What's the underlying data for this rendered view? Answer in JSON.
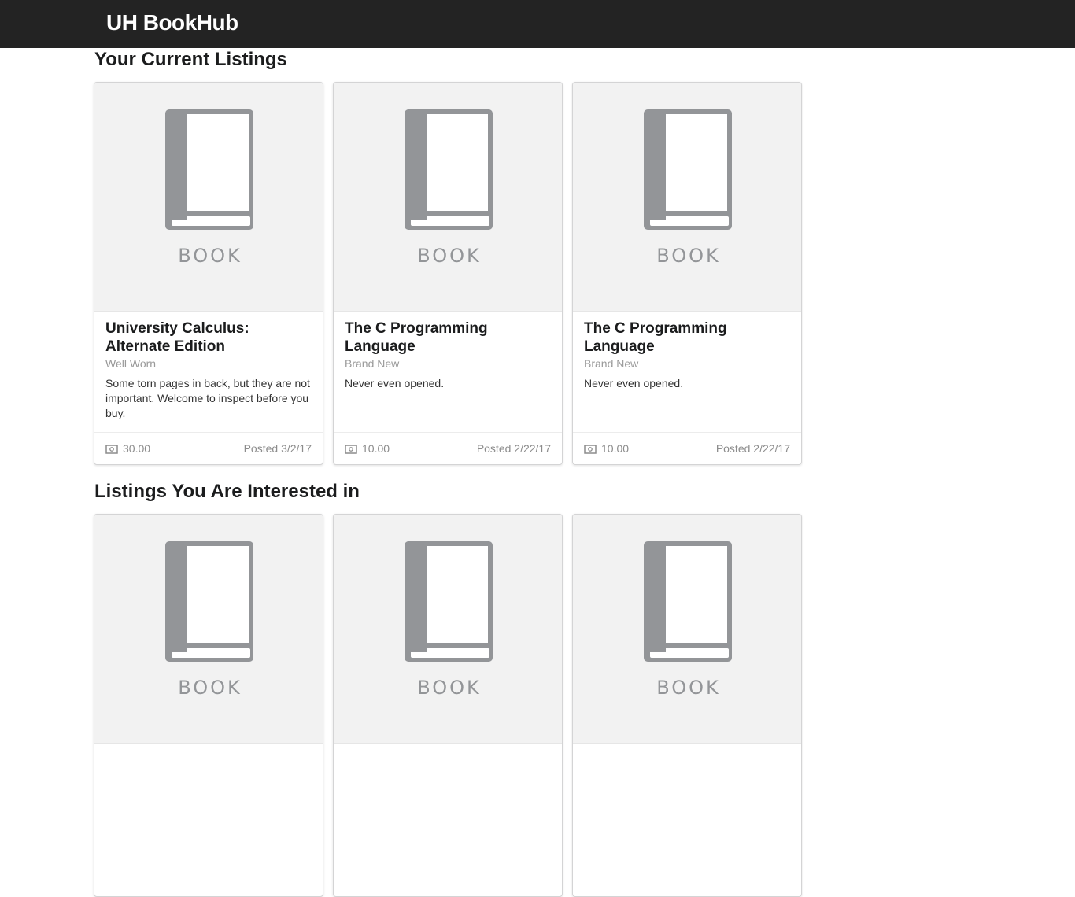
{
  "app": {
    "brand": "UH BookHub"
  },
  "sections": [
    {
      "title": "Your Current Listings",
      "cards": [
        {
          "image_label": "BOOK",
          "title": "University Calculus: Alternate Edition",
          "condition": "Well Worn",
          "description": "Some torn pages in back, but they are not important. Welcome to inspect before you buy.",
          "price": "30.00",
          "posted": "Posted 3/2/17"
        },
        {
          "image_label": "BOOK",
          "title": "The C Programming Language",
          "condition": "Brand New",
          "description": "Never even opened.",
          "price": "10.00",
          "posted": "Posted 2/22/17"
        },
        {
          "image_label": "BOOK",
          "title": "The C Programming Language",
          "condition": "Brand New",
          "description": "Never even opened.",
          "price": "10.00",
          "posted": "Posted 2/22/17"
        }
      ]
    },
    {
      "title": "Listings You Are Interested in",
      "cards": [
        {
          "image_label": "BOOK"
        },
        {
          "image_label": "BOOK"
        },
        {
          "image_label": "BOOK"
        }
      ]
    }
  ],
  "icons": {
    "book_placeholder": "book-icon",
    "price": "money-icon"
  },
  "colors": {
    "topbar": "#232323",
    "book_gray": "#939598",
    "card_image_bg": "#f2f2f2"
  }
}
